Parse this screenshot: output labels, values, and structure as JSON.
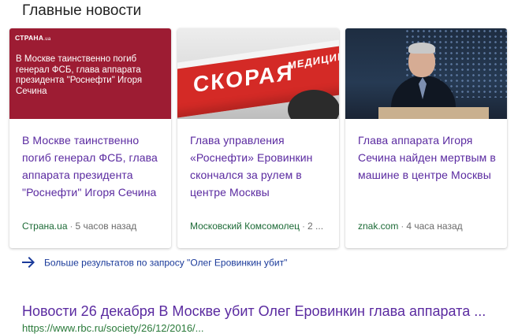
{
  "section_title": "Главные новости",
  "cards": [
    {
      "thumb_brand": "СТРАНА",
      "thumb_brand_suffix": ".ua",
      "thumb_text": "В Москве таинственно погиб генерал ФСБ, глава аппарата президента \"Роснефти\" Игоря Сечина",
      "headline": "В Москве таинственно погиб генерал ФСБ, глава аппарата президента \"Роснефти\" Игоря Сечина",
      "source": "Страна.ua",
      "time": "5 часов назад"
    },
    {
      "thumb_text_main": "СКОРАЯ",
      "thumb_text_secondary": "МЕДИЦИНСКАЯ",
      "headline": "Глава управления «Роснефти» Еровинкин скончался за рулем в центре Москвы",
      "source": "Московский Комсомолец",
      "time": "2 ..."
    },
    {
      "headline": "Глава аппарата Игоря Сечина найден мертвым в машине в центре Москвы",
      "source": "znak.com",
      "time": "4 часа назад"
    }
  ],
  "more_results": {
    "label": "Больше результатов по запросу \"Олег Еровинкин убит\"",
    "icon": "arrow-right-icon"
  },
  "result": {
    "title": "Новости 26 декабря В Москве убит Олег Еровинкин глава аппарата ...",
    "url": "https://www.rbc.ru/society/26/12/2016/..."
  },
  "colors": {
    "headline_link": "#5a2aa0",
    "source_green": "#1c6a36",
    "more_link": "#1a3a9a",
    "strana_brand": "#9d1c33",
    "ambulance_red": "#d42a26"
  }
}
